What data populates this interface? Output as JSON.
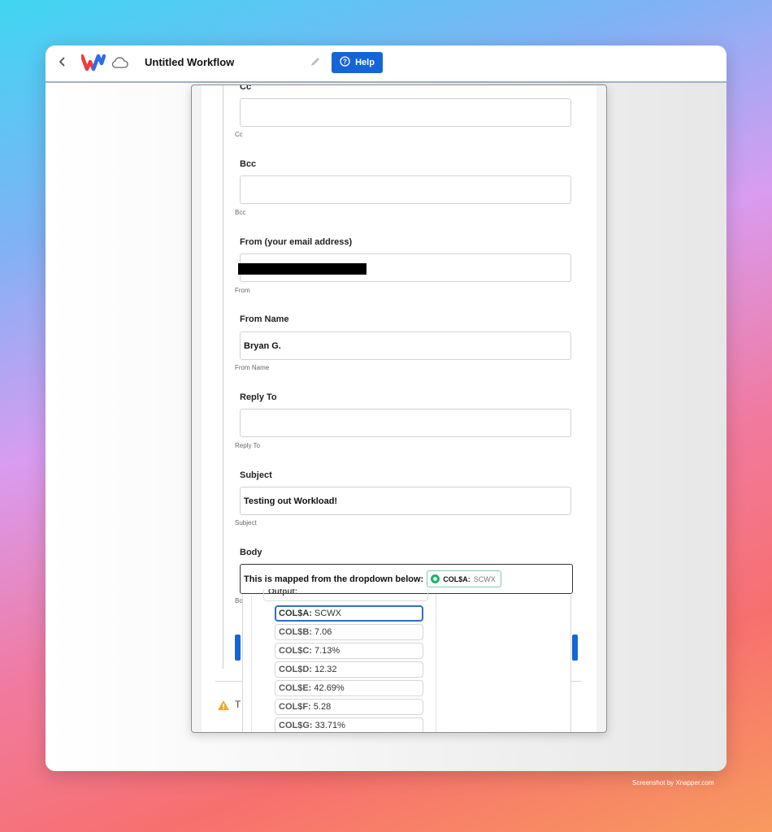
{
  "header": {
    "title": "Untitled Workflow",
    "help_label": "Help"
  },
  "form": {
    "cc": {
      "label": "Cc",
      "value": "",
      "hint": "Cc"
    },
    "bcc": {
      "label": "Bcc",
      "value": "",
      "hint": "Bcc"
    },
    "from": {
      "label": "From (your email address)",
      "value": "",
      "hint": "From"
    },
    "from_name": {
      "label": "From Name",
      "value": "Bryan G.",
      "hint": "From Name"
    },
    "reply_to": {
      "label": "Reply To",
      "value": "",
      "hint": "Reply To"
    },
    "subject": {
      "label": "Subject",
      "value": "Testing out Workload!",
      "hint": "Subject"
    },
    "body": {
      "label": "Body",
      "text": "This is mapped from the dropdown below:",
      "chip_key": "COL$A:",
      "chip_value": "SCWX",
      "hint": "Bo"
    }
  },
  "dropdown": {
    "output_label": "Output:",
    "options": [
      {
        "key": "COL$A:",
        "value": "SCWX"
      },
      {
        "key": "COL$B:",
        "value": "7.06"
      },
      {
        "key": "COL$C:",
        "value": "7.13%"
      },
      {
        "key": "COL$D:",
        "value": "12.32"
      },
      {
        "key": "COL$E:",
        "value": "42.69%"
      },
      {
        "key": "COL$F:",
        "value": "5.28"
      },
      {
        "key": "COL$G:",
        "value": "33.71%"
      }
    ]
  },
  "warning_text": "T",
  "footer_note": "Screenshot by Xnapper.com",
  "colors": {
    "accent": "#1565d8",
    "chip_dot": "#1fb36b",
    "selected_border": "#2f6fc1",
    "warning": "#f5a623"
  }
}
